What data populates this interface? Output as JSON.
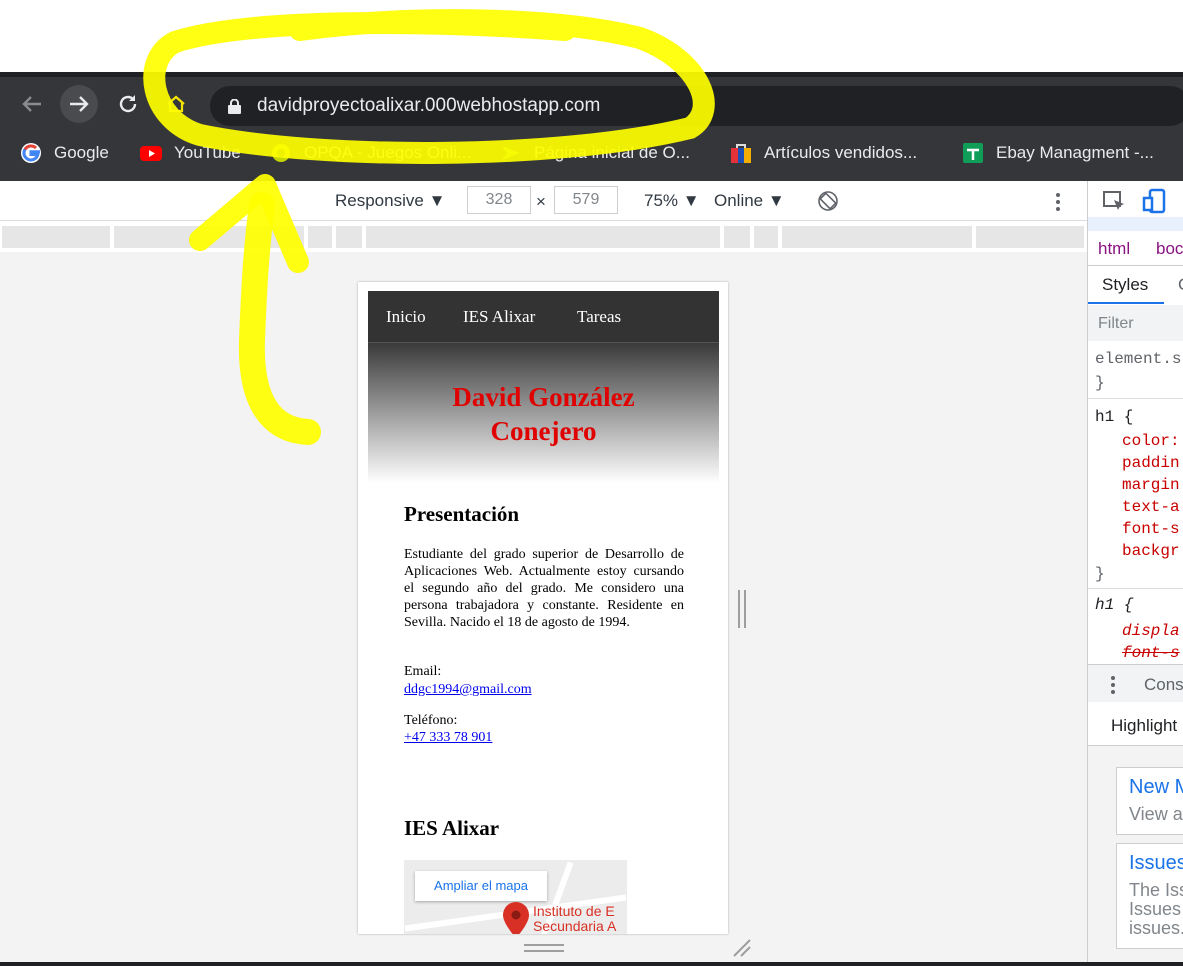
{
  "browser": {
    "url": "davidproyectoalixar.000webhostapp.com",
    "bookmarks": [
      {
        "label": "Google",
        "icon": "google-icon"
      },
      {
        "label": "YouTube",
        "icon": "youtube-icon"
      },
      {
        "label": "OPQA - Juegos Onli...",
        "icon": "opqa-icon"
      },
      {
        "label": "Página inicial de O...",
        "icon": "site-icon"
      },
      {
        "label": "Artículos vendidos...",
        "icon": "bag-icon"
      },
      {
        "label": "Ebay Managment -...",
        "icon": "sheets-icon"
      }
    ]
  },
  "devtools_toolbar": {
    "device": "Responsive",
    "width": "328",
    "times": "×",
    "height": "579",
    "zoom": "75%",
    "network": "Online"
  },
  "site": {
    "nav": [
      "Inicio",
      "IES Alixar",
      "Tareas"
    ],
    "title_line1": "David González",
    "title_line2": "Conejero",
    "presentation_heading": "Presentación",
    "presentation_text": "Estudiante del grado superior de Desarrollo de Aplicaciones Web. Actualmente estoy cursando el segundo año del grado. Me considero una persona trabajadora y constante. Residente en Sevilla. Nacido el 18 de agosto de 1994.",
    "email_label": "Email:",
    "email": "ddgc1994@gmail.com",
    "phone_label": "Teléfono:",
    "phone": "+47 333 78 901",
    "ies_heading": "IES Alixar",
    "map_button": "Ampliar el mapa",
    "map_label_line1": "Instituto de E",
    "map_label_line2": "Secundaria A"
  },
  "devtools_panel": {
    "breadcrumb_html": "html",
    "breadcrumb_body": "boc",
    "tab_styles": "Styles",
    "tab_computed": "C",
    "filter_placeholder": "Filter",
    "element_style": "element.s",
    "brace_close": "}",
    "h1_selector": "h1 {",
    "props": [
      "color:",
      "paddin",
      "margin",
      "text-a",
      "font-s",
      "backgr"
    ],
    "h1_selector2": "h1 {",
    "props2": [
      "displa",
      "font-s"
    ],
    "console_tab": "Cons",
    "highlights_tab": "Highlight",
    "card1_title": "New M",
    "card1_text": "View a",
    "card2_title": "Issues",
    "card2_line1": "The Iss",
    "card2_line2": "Issues",
    "card2_line3": "issues."
  },
  "colors": {
    "chrome_bg": "#35363a",
    "omnibox_bg": "#202124",
    "heading_red": "#e00000",
    "link_blue": "#0000ee",
    "annotation_yellow": "#ffff00"
  }
}
